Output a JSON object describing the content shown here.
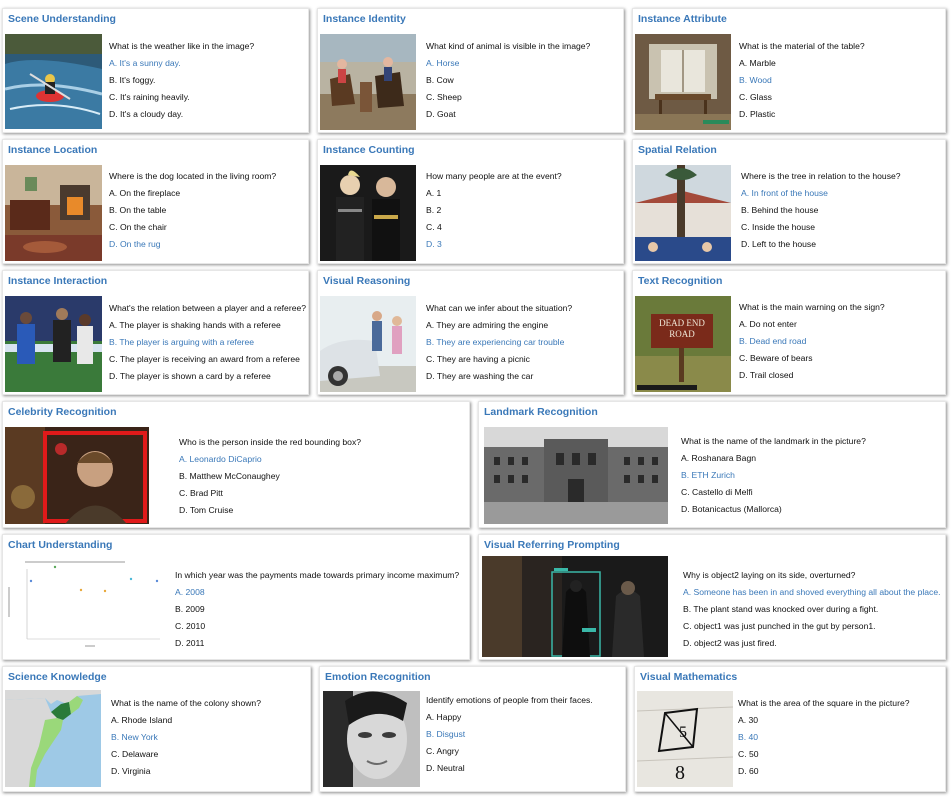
{
  "colors": {
    "title": "#3a78b8",
    "correct": "#3a78b8",
    "text": "#111111"
  },
  "cards": [
    {
      "title": "Scene Understanding",
      "question": "What is the weather like in the image?",
      "options": [
        "A. It's a sunny day.",
        "B. It's foggy.",
        "C. It's raining heavily.",
        "D. It's a cloudy day."
      ],
      "answer": 0
    },
    {
      "title": "Instance Identity",
      "question": "What kind of animal is visible in the image?",
      "options": [
        "A. Horse",
        "B. Cow",
        "C. Sheep",
        "D. Goat"
      ],
      "answer": 0
    },
    {
      "title": "Instance Attribute",
      "question": "What is the material of the table?",
      "options": [
        "A. Marble",
        "B. Wood",
        "C. Glass",
        "D. Plastic"
      ],
      "answer": 1
    },
    {
      "title": "Instance Location",
      "question": "Where is the dog located in the living room?",
      "options": [
        "A. On the fireplace",
        "B. On the table",
        "C. On the chair",
        "D. On the rug"
      ],
      "answer": 3
    },
    {
      "title": "Instance Counting",
      "question": "How many people are at the event?",
      "options": [
        "A. 1",
        "B. 2",
        "C. 4",
        "D. 3"
      ],
      "answer": 3
    },
    {
      "title": "Spatial Relation",
      "question": "Where is the tree in relation to the house?",
      "options": [
        "A. In front of the house",
        "B. Behind the house",
        "C. Inside the house",
        "D. Left to the house"
      ],
      "answer": 0
    },
    {
      "title": "Instance Interaction",
      "question": "What's the relation between a player and a referee?",
      "options": [
        "A. The player is shaking hands with a referee",
        "B. The player is arguing with a referee",
        "C. The player is receiving an award from a referee",
        "D. The player is shown a card by a referee"
      ],
      "answer": 1
    },
    {
      "title": "Visual Reasoning",
      "question": "What can we infer about the situation?",
      "options": [
        "A. They are admiring the engine",
        "B. They are experiencing car trouble",
        "C. They are having a picnic",
        "D. They are washing the car"
      ],
      "answer": 1
    },
    {
      "title": "Text Recognition",
      "question": "What is the main warning on the sign?",
      "options": [
        "A. Do not enter",
        "B. Dead end road",
        "C. Beware of bears",
        "D. Trail closed"
      ],
      "answer": 1,
      "sign_text": [
        "DEAD END",
        "ROAD"
      ]
    },
    {
      "title": "Celebrity Recognition",
      "question": "Who is the person inside the red bounding box?",
      "options": [
        "A. Leonardo DiCaprio",
        "B. Matthew McConaughey",
        "C. Brad Pitt",
        "D. Tom Cruise"
      ],
      "answer": 0
    },
    {
      "title": "Landmark Recognition",
      "question": "What is the name of the landmark in the picture?",
      "options": [
        "A. Roshanara Bagn",
        "B. ETH Zurich",
        "C. Castello di Melfi",
        "D. Botanicactus (Mallorca)"
      ],
      "answer": 1
    },
    {
      "title": "Chart Understanding",
      "question": "In which year was the payments made towards primary income maximum?",
      "options": [
        "A. 2008",
        "B. 2009",
        "C. 2010",
        "D. 2011"
      ],
      "answer": 0
    },
    {
      "title": "Visual Referring Prompting",
      "question": "Why is object2 laying on its side, overturned?",
      "options": [
        "A. Someone has been in and shoved everything all about the place.",
        "B. The plant stand was knocked over during a fight.",
        "C. object1 was just punched in the gut by person1.",
        "D. object2 was just fired."
      ],
      "answer": 0
    },
    {
      "title": "Science Knowledge",
      "question": "What is the name of the colony shown?",
      "options": [
        "A. Rhode Island",
        "B. New York",
        "C. Delaware",
        "D. Virginia"
      ],
      "answer": 1
    },
    {
      "title": "Emotion Recognition",
      "question": "Identify emotions of people from their faces.",
      "options": [
        "A. Happy",
        "B. Disgust",
        "C. Angry",
        "D. Neutral"
      ],
      "answer": 1
    },
    {
      "title": "Visual Mathematics",
      "question": "What is the area of the square in the picture?",
      "options": [
        "A. 30",
        "B. 40",
        "C. 50",
        "D. 60"
      ],
      "answer": 1,
      "handwriting": [
        "5",
        "8"
      ]
    }
  ]
}
